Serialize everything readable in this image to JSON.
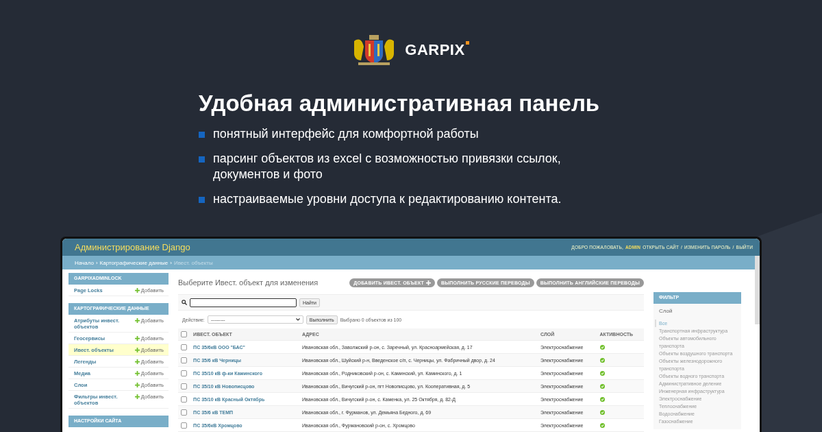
{
  "brand": {
    "name": "GARPIX"
  },
  "headline": "Удобная административная панель",
  "bullets": [
    "понятный интерфейс для комфортной работы",
    "парсинг объектов из excel с возможностью привязки ссылок, документов и фото",
    "настраиваемые уровни доступа к редактированию контента."
  ],
  "admin": {
    "site_title": "Администрирование Django",
    "user_tools": {
      "welcome": "ДОБРО ПОЖАЛОВАТЬ,",
      "user": "ADMIN",
      "links": [
        "ОТКРЫТЬ САЙТ",
        "ИЗМЕНИТЬ ПАРОЛЬ",
        "ВЫЙТИ"
      ],
      "separator": "/"
    },
    "breadcrumbs": {
      "links": [
        "Начало",
        "Картографические данные"
      ],
      "current": "Ивест. объекты",
      "separator": "›"
    },
    "sidebar": [
      {
        "caption": "GARPIXADMINLOCK",
        "items": [
          {
            "name": "Page Locks",
            "add": "Добавить",
            "selected": false
          }
        ]
      },
      {
        "caption": "КАРТОГРАФИЧЕСКИЕ ДАННЫЕ",
        "items": [
          {
            "name": "Атрибуты инвест. объектов",
            "add": "Добавить",
            "selected": false
          },
          {
            "name": "Геосервисы",
            "add": "Добавить",
            "selected": false
          },
          {
            "name": "Ивест. объекты",
            "add": "Добавить",
            "selected": true
          },
          {
            "name": "Легенды",
            "add": "Добавить",
            "selected": false
          },
          {
            "name": "Медиа",
            "add": "Добавить",
            "selected": false
          },
          {
            "name": "Слои",
            "add": "Добавить",
            "selected": false
          },
          {
            "name": "Фильтры инвест. объектов",
            "add": "Добавить",
            "selected": false
          }
        ]
      },
      {
        "caption": "НАСТРОЙКИ САЙТА"
      }
    ],
    "page_title": "Выберите Ивест. объект для изменения",
    "object_tools": [
      "ДОБАВИТЬ ИВЕСТ. ОБЪЕКТ",
      "ВЫПОЛНИТЬ РУССКИЕ ПЕРЕВОДЫ",
      "ВЫПОЛНИТЬ АНГЛИЙСКИЕ ПЕРЕВОДЫ"
    ],
    "search": {
      "button": "Найти"
    },
    "actions": {
      "label": "Действие:",
      "value": "---------",
      "button": "Выполнить",
      "counter": "Выбрано 0 объектов из 100"
    },
    "table": {
      "all_selected": false,
      "columns": [
        "ИВЕСТ. ОБЪЕКТ",
        "АДРЕС",
        "СЛОЙ",
        "АКТИВНОСТЬ"
      ],
      "rows": [
        {
          "name": "ПС 35/6кВ ООО \"БАС\"",
          "address": "Ивановская обл., Заволжский р-он, с. Заречный, ул. Красноармейская, д. 17",
          "layer": "Электроснабжение",
          "active": true,
          "checked": false
        },
        {
          "name": "ПС 35/6 кВ Черницы",
          "address": "Ивановская обл., Шуйский р-н, Введенское с/п, с. Черницы, ул. Фабричный двор, д. 24",
          "layer": "Электроснабжение",
          "active": true,
          "checked": false
        },
        {
          "name": "ПС 35/10 кВ ф-ки Каминского",
          "address": "Ивановская обл., Родниковский р-он, с. Каминский, ул. Каминского, д. 1",
          "layer": "Электроснабжение",
          "active": true,
          "checked": false
        },
        {
          "name": "ПС 35/10 кВ Новописцово",
          "address": "Ивановская обл., Вичугский р-он, пгт Новописцово, ул. Кооперативная, д. 5",
          "layer": "Электроснабжение",
          "active": true,
          "checked": false
        },
        {
          "name": "ПС 35/10 кВ Красный Октябрь",
          "address": "Ивановская обл., Вичугский р-он, с. Каменка, ул. 25 Октября, д. 82-Д",
          "layer": "Электроснабжение",
          "active": true,
          "checked": false
        },
        {
          "name": "ПС 35/6 кВ ТЕМП",
          "address": "Ивановская обл., г. Фурманов, ул. Демьяна Бедного, д. 69",
          "layer": "Электроснабжение",
          "active": true,
          "checked": false
        },
        {
          "name": "ПС 35/6кВ Хромцово",
          "address": "Ивановская обл., Фурмановский р-он, с. Хромцово",
          "layer": "Электроснабжение",
          "active": true,
          "checked": false
        }
      ]
    },
    "filter": {
      "caption": "ФИЛЬТР",
      "group": "Слой",
      "items": [
        {
          "label": "Все",
          "selected": true
        },
        {
          "label": "Транспортная инфраструктура",
          "selected": false
        },
        {
          "label": "Объекты автомобильного транспорта",
          "selected": false
        },
        {
          "label": "Объекты воздушного транспорта",
          "selected": false
        },
        {
          "label": "Объекты железнодорожного транспорта",
          "selected": false
        },
        {
          "label": "Объекты водного транспорта",
          "selected": false
        },
        {
          "label": "Административное деление",
          "selected": false
        },
        {
          "label": "Инженерная инфраструктура",
          "selected": false
        },
        {
          "label": "Электроснабжение",
          "selected": false
        },
        {
          "label": "Теплоснабжение",
          "selected": false
        },
        {
          "label": "Водоснабжение",
          "selected": false
        },
        {
          "label": "Газоснабжение",
          "selected": false
        }
      ]
    }
  }
}
